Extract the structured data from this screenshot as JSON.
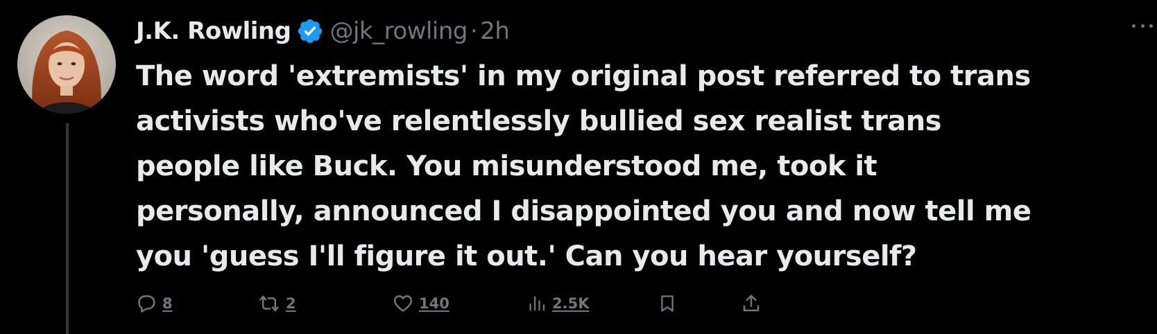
{
  "tweet": {
    "author": {
      "display_name": "J.K. Rowling",
      "handle": "@jk_rowling",
      "verified": true
    },
    "separator": "·",
    "time": "2h",
    "text_lines": [
      "The word 'extremists' in my original post referred to trans",
      "activists who've relentlessly bullied sex realist trans",
      "people like Buck. You misunderstood me, took it",
      "personally, announced I disappointed you and now tell me",
      "you 'guess I'll figure it out.' Can you hear yourself?"
    ],
    "actions": {
      "replies": "8",
      "reposts": "2",
      "likes": "140",
      "views": "2.5K"
    }
  },
  "icons": {
    "verified": "verified-badge-icon",
    "more": "more-options-icon",
    "reply": "reply-icon",
    "repost": "repost-icon",
    "like": "heart-icon",
    "views": "views-chart-icon",
    "bookmark": "bookmark-icon",
    "share": "share-icon"
  },
  "colors": {
    "background": "#000000",
    "text": "#e7e9ea",
    "secondary_text": "#71767b",
    "verified_blue": "#1d9bf0",
    "thread_line": "#333639"
  }
}
